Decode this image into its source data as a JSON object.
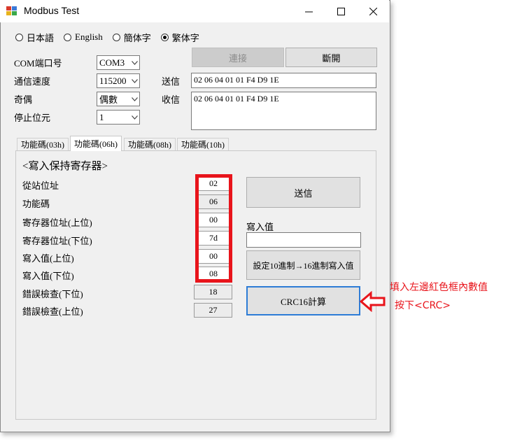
{
  "window": {
    "title": "Modbus Test"
  },
  "languages": [
    {
      "label": "日本語",
      "selected": false
    },
    {
      "label": "English",
      "selected": false
    },
    {
      "label": "簡体字",
      "selected": false
    },
    {
      "label": "繁体字",
      "selected": true
    }
  ],
  "settings": {
    "com_label": "COM端口号",
    "com_value": "COM3",
    "baud_label": "通信速度",
    "baud_value": "115200",
    "parity_label": "奇偶",
    "parity_value": "偶數",
    "stop_label": "停止位元",
    "stop_value": "1"
  },
  "connection": {
    "connect_label": "連接",
    "disconnect_label": "斷開"
  },
  "io": {
    "send_label": "送信",
    "send_value": "02 06 04 01 01 F4 D9 1E",
    "recv_label": "收信",
    "recv_value": "02 06 04 01 01 F4 D9 1E"
  },
  "tabs": [
    {
      "label": "功能碼(03h)",
      "active": false
    },
    {
      "label": "功能碼(06h)",
      "active": true
    },
    {
      "label": "功能碼(08h)",
      "active": false
    },
    {
      "label": "功能碼(10h)",
      "active": false
    }
  ],
  "panel": {
    "heading": "<寫入保持寄存器>",
    "fields": [
      {
        "label": "從站位址",
        "value": "02"
      },
      {
        "label": "功能碼",
        "value": "06"
      },
      {
        "label": "寄存器位址(上位)",
        "value": "00"
      },
      {
        "label": "寄存器位址(下位)",
        "value": "7d"
      },
      {
        "label": "寫入值(上位)",
        "value": "00"
      },
      {
        "label": "寫入值(下位)",
        "value": "08"
      },
      {
        "label": "錯誤檢查(下位)",
        "value": "18"
      },
      {
        "label": "錯誤檢查(上位)",
        "value": "27"
      }
    ],
    "send_button": "送信",
    "write_value_label": "寫入值",
    "write_value": "",
    "convert_button": "設定10進制→16進制寫入值",
    "crc_button": "CRC16計算"
  },
  "annotation": {
    "line1": "填入左邊紅色框內數值",
    "line2": "按下<CRC>",
    "color": "#e8141b"
  }
}
